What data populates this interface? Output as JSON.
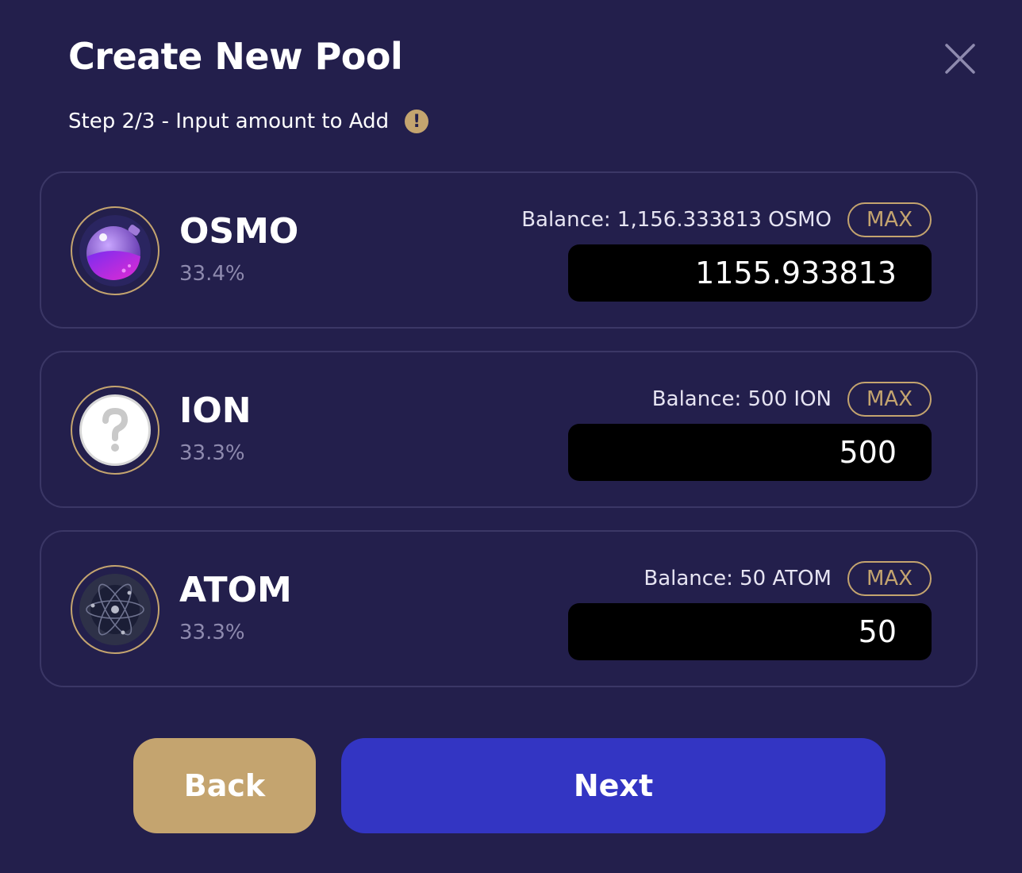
{
  "header": {
    "title": "Create New Pool",
    "step_text": "Step 2/3 - Input amount to Add",
    "info_icon": "exclamation-icon",
    "close_icon": "close-icon"
  },
  "tokens": [
    {
      "symbol": "OSMO",
      "percent": "33.4%",
      "balance": "Balance: 1,156.333813 OSMO",
      "max_label": "MAX",
      "amount": "1155.933813",
      "icon": "osmo-icon"
    },
    {
      "symbol": "ION",
      "percent": "33.3%",
      "balance": "Balance: 500 ION",
      "max_label": "MAX",
      "amount": "500",
      "icon": "question-icon"
    },
    {
      "symbol": "ATOM",
      "percent": "33.3%",
      "balance": "Balance: 50 ATOM",
      "max_label": "MAX",
      "amount": "50",
      "icon": "atom-icon"
    }
  ],
  "actions": {
    "back_label": "Back",
    "next_label": "Next"
  },
  "colors": {
    "background": "#231f4c",
    "accent_gold": "#c4a46f",
    "primary_button": "#3335c3",
    "card_border": "#3b3766",
    "muted_text": "#8e8aae"
  }
}
